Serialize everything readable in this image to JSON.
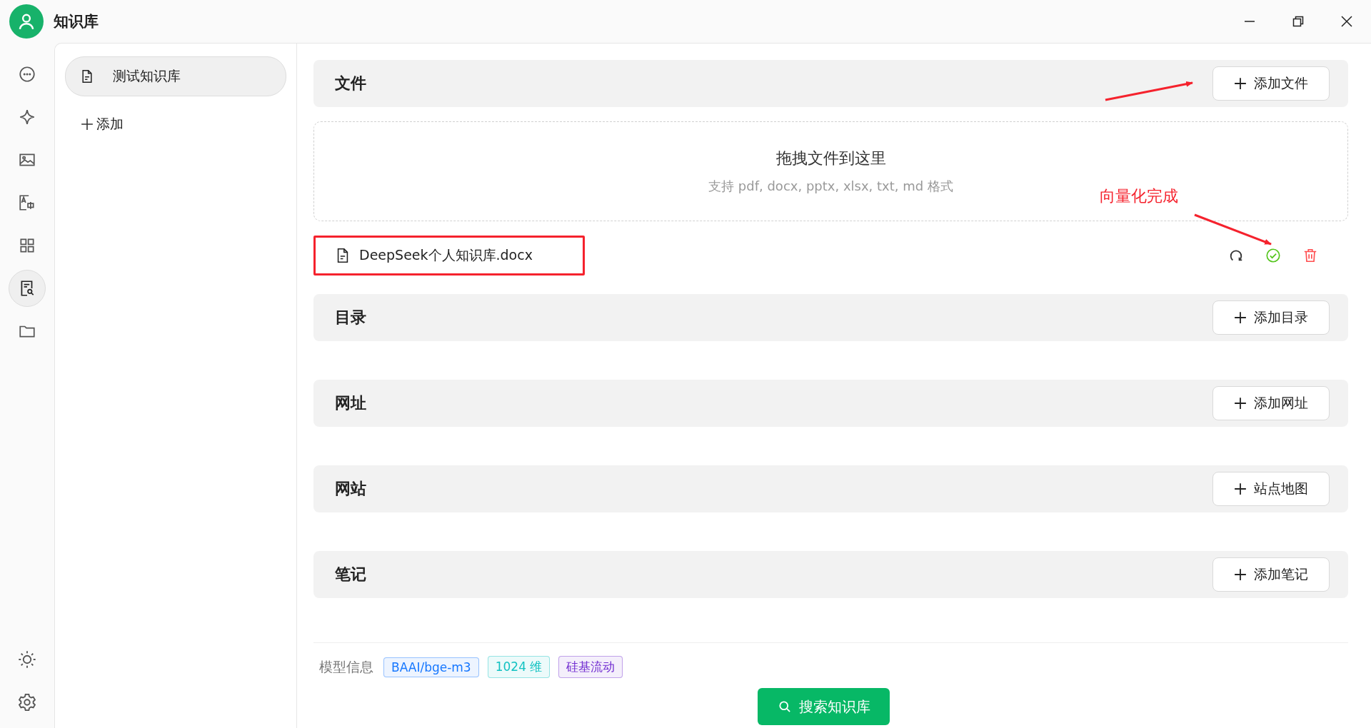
{
  "window": {
    "title": "知识库"
  },
  "rail": [
    {
      "kind": "chat",
      "selected": false
    },
    {
      "kind": "sparkle",
      "selected": false
    },
    {
      "kind": "image",
      "selected": false
    },
    {
      "kind": "translate",
      "selected": false
    },
    {
      "kind": "apps",
      "selected": false
    },
    {
      "kind": "knowledge",
      "selected": true
    },
    {
      "kind": "folder",
      "selected": false
    }
  ],
  "sidebar": {
    "items": [
      {
        "label": "测试知识库",
        "selected": true
      }
    ],
    "add_label": "添加"
  },
  "sections": [
    {
      "title": "文件",
      "button": "添加文件",
      "dropzone": {
        "title": "拖拽文件到这里",
        "hint": "支持 pdf, docx, pptx, xlsx, txt, md 格式"
      },
      "files": [
        {
          "name": "DeepSeek个人知识库.docx",
          "vectorized": true
        }
      ]
    },
    {
      "title": "目录",
      "button": "添加目录"
    },
    {
      "title": "网址",
      "button": "添加网址"
    },
    {
      "title": "网站",
      "button": "站点地图"
    },
    {
      "title": "笔记",
      "button": "添加笔记"
    }
  ],
  "model_info": {
    "label": "模型信息",
    "tags": [
      {
        "text": "BAAI/bge-m3",
        "color": "#1677ff"
      },
      {
        "text": "1024 维",
        "color": "#13c2c2"
      },
      {
        "text": "硅基流动",
        "color": "#722ed1"
      }
    ]
  },
  "search_button": "搜索知识库",
  "annotation": {
    "label": "向量化完成"
  }
}
